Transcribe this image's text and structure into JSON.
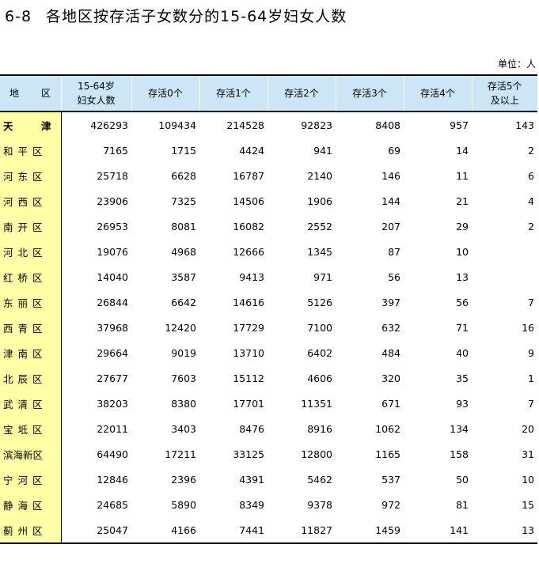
{
  "title": {
    "number": "6-8",
    "text": "各地区按存活子女数分的15-64岁妇女人数"
  },
  "unit": "单位：人",
  "headers": {
    "region": [
      "地",
      "区"
    ],
    "women_line1": "15-64岁",
    "women_line2": "妇女人数",
    "c0": "存活0个",
    "c1": "存活1个",
    "c2": "存活2个",
    "c3": "存活3个",
    "c4": "存活4个",
    "c5_line1": "存活5个",
    "c5_line2": "及以上"
  },
  "total": {
    "region": [
      "天",
      "津"
    ],
    "women": "426293",
    "c0": "109434",
    "c1": "214528",
    "c2": "92823",
    "c3": "8408",
    "c4": "957",
    "c5": "143"
  },
  "rows": [
    {
      "region": "和平区",
      "women": "7165",
      "c0": "1715",
      "c1": "4424",
      "c2": "941",
      "c3": "69",
      "c4": "14",
      "c5": "2"
    },
    {
      "region": "河东区",
      "women": "25718",
      "c0": "6628",
      "c1": "16787",
      "c2": "2140",
      "c3": "146",
      "c4": "11",
      "c5": "6"
    },
    {
      "region": "河西区",
      "women": "23906",
      "c0": "7325",
      "c1": "14506",
      "c2": "1906",
      "c3": "144",
      "c4": "21",
      "c5": "4"
    },
    {
      "region": "南开区",
      "women": "26953",
      "c0": "8081",
      "c1": "16082",
      "c2": "2552",
      "c3": "207",
      "c4": "29",
      "c5": "2"
    },
    {
      "region": "河北区",
      "women": "19076",
      "c0": "4968",
      "c1": "12666",
      "c2": "1345",
      "c3": "87",
      "c4": "10",
      "c5": ""
    },
    {
      "region": "红桥区",
      "women": "14040",
      "c0": "3587",
      "c1": "9413",
      "c2": "971",
      "c3": "56",
      "c4": "13",
      "c5": ""
    },
    {
      "region": "东丽区",
      "women": "26844",
      "c0": "6642",
      "c1": "14616",
      "c2": "5126",
      "c3": "397",
      "c4": "56",
      "c5": "7"
    },
    {
      "region": "西青区",
      "women": "37968",
      "c0": "12420",
      "c1": "17729",
      "c2": "7100",
      "c3": "632",
      "c4": "71",
      "c5": "16"
    },
    {
      "region": "津南区",
      "women": "29664",
      "c0": "9019",
      "c1": "13710",
      "c2": "6402",
      "c3": "484",
      "c4": "40",
      "c5": "9"
    },
    {
      "region": "北辰区",
      "women": "27677",
      "c0": "7603",
      "c1": "15112",
      "c2": "4606",
      "c3": "320",
      "c4": "35",
      "c5": "1"
    },
    {
      "region": "武清区",
      "women": "38203",
      "c0": "8380",
      "c1": "17701",
      "c2": "11351",
      "c3": "671",
      "c4": "93",
      "c5": "7"
    },
    {
      "region": "宝坻区",
      "women": "22011",
      "c0": "3403",
      "c1": "8476",
      "c2": "8916",
      "c3": "1062",
      "c4": "134",
      "c5": "20"
    },
    {
      "region": "滨海新区",
      "women": "64490",
      "c0": "17211",
      "c1": "33125",
      "c2": "12800",
      "c3": "1165",
      "c4": "158",
      "c5": "31"
    },
    {
      "region": "宁河区",
      "women": "12846",
      "c0": "2396",
      "c1": "4391",
      "c2": "5462",
      "c3": "537",
      "c4": "50",
      "c5": "10"
    },
    {
      "region": "静海区",
      "women": "24685",
      "c0": "5890",
      "c1": "8349",
      "c2": "9378",
      "c3": "972",
      "c4": "81",
      "c5": "15"
    },
    {
      "region": "蓟州区",
      "women": "25047",
      "c0": "4166",
      "c1": "7441",
      "c2": "11827",
      "c3": "1459",
      "c4": "141",
      "c5": "13"
    }
  ]
}
